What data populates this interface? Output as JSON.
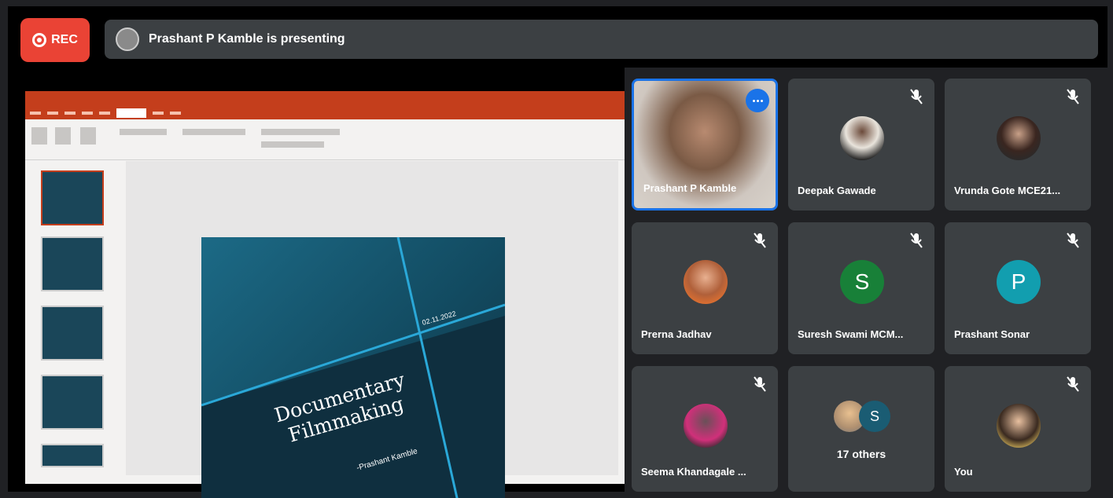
{
  "rec": {
    "label": "REC"
  },
  "presenting": {
    "text": "Prashant P Kamble is presenting"
  },
  "slide": {
    "title": "Documentary Filmmaking",
    "author": "-Prashant Kamble",
    "date": "02.11.2022"
  },
  "participants": [
    {
      "name": "Prashant P Kamble",
      "type": "video",
      "speaking": true
    },
    {
      "name": "Deepak Gawade",
      "type": "photo",
      "muted": true
    },
    {
      "name": "Vrunda Gote MCE21...",
      "type": "photo",
      "muted": true
    },
    {
      "name": "Prerna Jadhav",
      "type": "photo",
      "muted": true
    },
    {
      "name": "Suresh Swami MCM...",
      "type": "letter",
      "letter": "S",
      "color": "#188038",
      "muted": true
    },
    {
      "name": "Prashant Sonar",
      "type": "letter",
      "letter": "P",
      "color": "#129eaf",
      "muted": true
    },
    {
      "name": "Seema Khandagale ...",
      "type": "photo",
      "muted": true
    },
    {
      "name": "17 others",
      "type": "group",
      "letter": "S",
      "color": "#1a5c73"
    },
    {
      "name": "You",
      "type": "photo",
      "muted": true
    }
  ],
  "colors": {
    "accent": "#1a73e8",
    "rec": "#ea4335",
    "tile": "#3c4043",
    "ppt": "#c43e1c"
  }
}
